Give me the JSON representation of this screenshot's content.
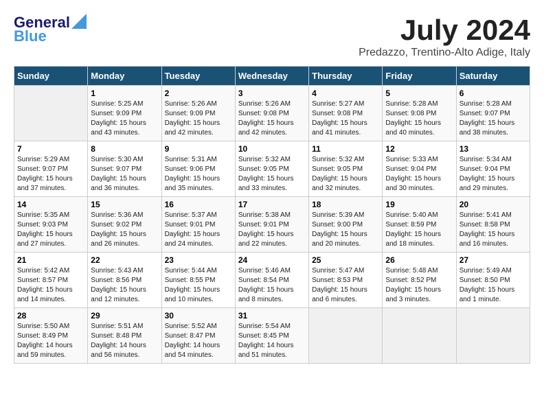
{
  "header": {
    "logo_line1": "General",
    "logo_line2": "Blue",
    "month": "July 2024",
    "location": "Predazzo, Trentino-Alto Adige, Italy"
  },
  "weekdays": [
    "Sunday",
    "Monday",
    "Tuesday",
    "Wednesday",
    "Thursday",
    "Friday",
    "Saturday"
  ],
  "weeks": [
    [
      {
        "day": "",
        "text": ""
      },
      {
        "day": "1",
        "text": "Sunrise: 5:25 AM\nSunset: 9:09 PM\nDaylight: 15 hours\nand 43 minutes."
      },
      {
        "day": "2",
        "text": "Sunrise: 5:26 AM\nSunset: 9:09 PM\nDaylight: 15 hours\nand 42 minutes."
      },
      {
        "day": "3",
        "text": "Sunrise: 5:26 AM\nSunset: 9:08 PM\nDaylight: 15 hours\nand 42 minutes."
      },
      {
        "day": "4",
        "text": "Sunrise: 5:27 AM\nSunset: 9:08 PM\nDaylight: 15 hours\nand 41 minutes."
      },
      {
        "day": "5",
        "text": "Sunrise: 5:28 AM\nSunset: 9:08 PM\nDaylight: 15 hours\nand 40 minutes."
      },
      {
        "day": "6",
        "text": "Sunrise: 5:28 AM\nSunset: 9:07 PM\nDaylight: 15 hours\nand 38 minutes."
      }
    ],
    [
      {
        "day": "7",
        "text": "Sunrise: 5:29 AM\nSunset: 9:07 PM\nDaylight: 15 hours\nand 37 minutes."
      },
      {
        "day": "8",
        "text": "Sunrise: 5:30 AM\nSunset: 9:07 PM\nDaylight: 15 hours\nand 36 minutes."
      },
      {
        "day": "9",
        "text": "Sunrise: 5:31 AM\nSunset: 9:06 PM\nDaylight: 15 hours\nand 35 minutes."
      },
      {
        "day": "10",
        "text": "Sunrise: 5:32 AM\nSunset: 9:05 PM\nDaylight: 15 hours\nand 33 minutes."
      },
      {
        "day": "11",
        "text": "Sunrise: 5:32 AM\nSunset: 9:05 PM\nDaylight: 15 hours\nand 32 minutes."
      },
      {
        "day": "12",
        "text": "Sunrise: 5:33 AM\nSunset: 9:04 PM\nDaylight: 15 hours\nand 30 minutes."
      },
      {
        "day": "13",
        "text": "Sunrise: 5:34 AM\nSunset: 9:04 PM\nDaylight: 15 hours\nand 29 minutes."
      }
    ],
    [
      {
        "day": "14",
        "text": "Sunrise: 5:35 AM\nSunset: 9:03 PM\nDaylight: 15 hours\nand 27 minutes."
      },
      {
        "day": "15",
        "text": "Sunrise: 5:36 AM\nSunset: 9:02 PM\nDaylight: 15 hours\nand 26 minutes."
      },
      {
        "day": "16",
        "text": "Sunrise: 5:37 AM\nSunset: 9:01 PM\nDaylight: 15 hours\nand 24 minutes."
      },
      {
        "day": "17",
        "text": "Sunrise: 5:38 AM\nSunset: 9:01 PM\nDaylight: 15 hours\nand 22 minutes."
      },
      {
        "day": "18",
        "text": "Sunrise: 5:39 AM\nSunset: 9:00 PM\nDaylight: 15 hours\nand 20 minutes."
      },
      {
        "day": "19",
        "text": "Sunrise: 5:40 AM\nSunset: 8:59 PM\nDaylight: 15 hours\nand 18 minutes."
      },
      {
        "day": "20",
        "text": "Sunrise: 5:41 AM\nSunset: 8:58 PM\nDaylight: 15 hours\nand 16 minutes."
      }
    ],
    [
      {
        "day": "21",
        "text": "Sunrise: 5:42 AM\nSunset: 8:57 PM\nDaylight: 15 hours\nand 14 minutes."
      },
      {
        "day": "22",
        "text": "Sunrise: 5:43 AM\nSunset: 8:56 PM\nDaylight: 15 hours\nand 12 minutes."
      },
      {
        "day": "23",
        "text": "Sunrise: 5:44 AM\nSunset: 8:55 PM\nDaylight: 15 hours\nand 10 minutes."
      },
      {
        "day": "24",
        "text": "Sunrise: 5:46 AM\nSunset: 8:54 PM\nDaylight: 15 hours\nand 8 minutes."
      },
      {
        "day": "25",
        "text": "Sunrise: 5:47 AM\nSunset: 8:53 PM\nDaylight: 15 hours\nand 6 minutes."
      },
      {
        "day": "26",
        "text": "Sunrise: 5:48 AM\nSunset: 8:52 PM\nDaylight: 15 hours\nand 3 minutes."
      },
      {
        "day": "27",
        "text": "Sunrise: 5:49 AM\nSunset: 8:50 PM\nDaylight: 15 hours\nand 1 minute."
      }
    ],
    [
      {
        "day": "28",
        "text": "Sunrise: 5:50 AM\nSunset: 8:49 PM\nDaylight: 14 hours\nand 59 minutes."
      },
      {
        "day": "29",
        "text": "Sunrise: 5:51 AM\nSunset: 8:48 PM\nDaylight: 14 hours\nand 56 minutes."
      },
      {
        "day": "30",
        "text": "Sunrise: 5:52 AM\nSunset: 8:47 PM\nDaylight: 14 hours\nand 54 minutes."
      },
      {
        "day": "31",
        "text": "Sunrise: 5:54 AM\nSunset: 8:45 PM\nDaylight: 14 hours\nand 51 minutes."
      },
      {
        "day": "",
        "text": ""
      },
      {
        "day": "",
        "text": ""
      },
      {
        "day": "",
        "text": ""
      }
    ]
  ]
}
